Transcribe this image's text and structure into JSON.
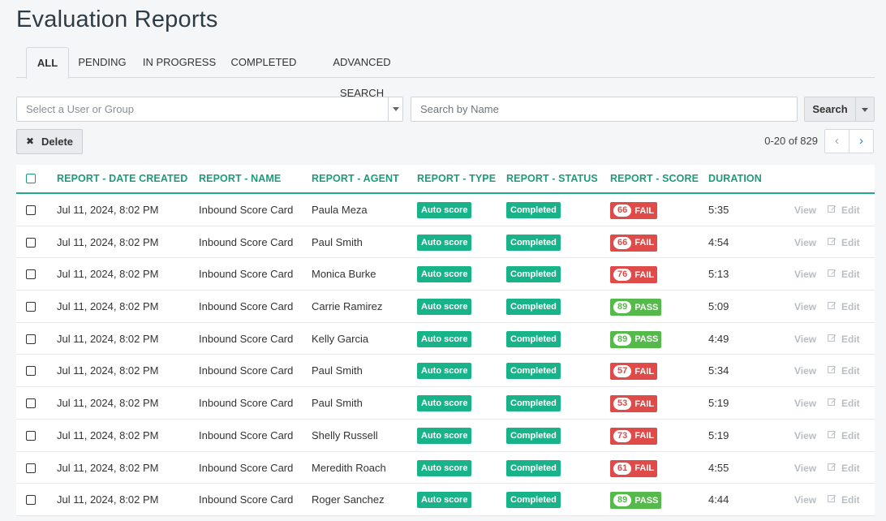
{
  "page": {
    "title": "Evaluation Reports"
  },
  "tabs": [
    {
      "label": "ALL",
      "active": true
    },
    {
      "label": "PENDING",
      "active": false
    },
    {
      "label": "IN PROGRESS",
      "active": false
    },
    {
      "label": "COMPLETED",
      "active": false
    },
    {
      "label": "ADVANCED SEARCH",
      "active": false
    }
  ],
  "filters": {
    "user_group_placeholder": "Select a User or Group",
    "search_placeholder": "Search by Name",
    "search_label": "Search"
  },
  "toolbar": {
    "delete_label": "Delete",
    "pagination": "0-20 of 829"
  },
  "table": {
    "columns": [
      "REPORT - DATE CREATED",
      "REPORT - NAME",
      "REPORT - AGENT",
      "REPORT - TYPE",
      "REPORT - STATUS",
      "REPORT - SCORE",
      "DURATION"
    ],
    "view_label": "View",
    "edit_label": "Edit",
    "rows": [
      {
        "date": "Jul 11, 2024, 8:02 PM",
        "name": "Inbound Score Card",
        "agent": "Paula Meza",
        "type": "Auto score",
        "status": "Completed",
        "score": "66",
        "result": "FAIL",
        "duration": "5:35"
      },
      {
        "date": "Jul 11, 2024, 8:02 PM",
        "name": "Inbound Score Card",
        "agent": "Paul Smith",
        "type": "Auto score",
        "status": "Completed",
        "score": "66",
        "result": "FAIL",
        "duration": "4:54"
      },
      {
        "date": "Jul 11, 2024, 8:02 PM",
        "name": "Inbound Score Card",
        "agent": "Monica Burke",
        "type": "Auto score",
        "status": "Completed",
        "score": "76",
        "result": "FAIL",
        "duration": "5:13"
      },
      {
        "date": "Jul 11, 2024, 8:02 PM",
        "name": "Inbound Score Card",
        "agent": "Carrie Ramirez",
        "type": "Auto score",
        "status": "Completed",
        "score": "89",
        "result": "PASS",
        "duration": "5:09"
      },
      {
        "date": "Jul 11, 2024, 8:02 PM",
        "name": "Inbound Score Card",
        "agent": "Kelly Garcia",
        "type": "Auto score",
        "status": "Completed",
        "score": "89",
        "result": "PASS",
        "duration": "4:49"
      },
      {
        "date": "Jul 11, 2024, 8:02 PM",
        "name": "Inbound Score Card",
        "agent": "Paul Smith",
        "type": "Auto score",
        "status": "Completed",
        "score": "57",
        "result": "FAIL",
        "duration": "5:34"
      },
      {
        "date": "Jul 11, 2024, 8:02 PM",
        "name": "Inbound Score Card",
        "agent": "Paul Smith",
        "type": "Auto score",
        "status": "Completed",
        "score": "53",
        "result": "FAIL",
        "duration": "5:19"
      },
      {
        "date": "Jul 11, 2024, 8:02 PM",
        "name": "Inbound Score Card",
        "agent": "Shelly Russell",
        "type": "Auto score",
        "status": "Completed",
        "score": "73",
        "result": "FAIL",
        "duration": "5:19"
      },
      {
        "date": "Jul 11, 2024, 8:02 PM",
        "name": "Inbound Score Card",
        "agent": "Meredith Roach",
        "type": "Auto score",
        "status": "Completed",
        "score": "61",
        "result": "FAIL",
        "duration": "4:55"
      },
      {
        "date": "Jul 11, 2024, 8:02 PM",
        "name": "Inbound Score Card",
        "agent": "Roger Sanchez",
        "type": "Auto score",
        "status": "Completed",
        "score": "89",
        "result": "PASS",
        "duration": "4:44"
      }
    ]
  }
}
